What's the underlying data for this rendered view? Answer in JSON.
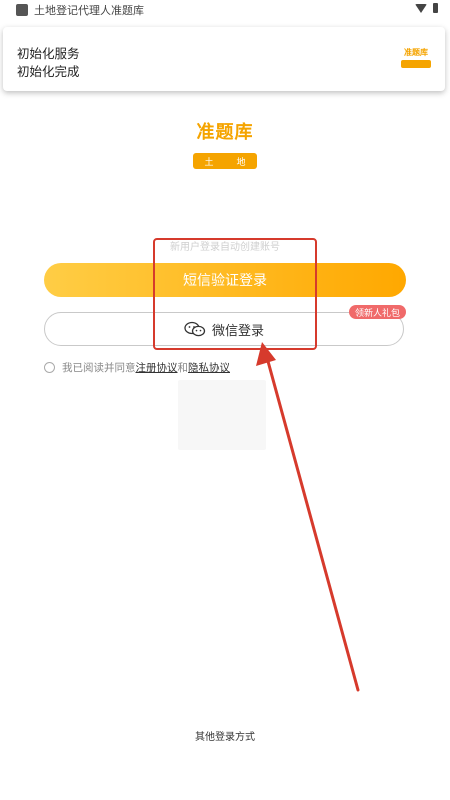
{
  "status_bar": {
    "title": "土地登记代理人准题库"
  },
  "notification": {
    "line1": "初始化服务",
    "line2": "初始化完成",
    "logo_text": "准题库"
  },
  "logo": {
    "title": "准题库",
    "ribbon_left": "土",
    "ribbon_right": "地"
  },
  "login": {
    "hint": "新用户登录自动创建账号",
    "sms_button": "短信验证登录",
    "wechat_button": "微信登录",
    "gift_badge": "领新人礼包",
    "agreement_prefix": "我已阅读并同意",
    "agreement_terms": "注册协议",
    "agreement_and": "和",
    "agreement_privacy": "隐私协议",
    "other_methods": "其他登录方式"
  },
  "colors": {
    "accent": "#f5a400",
    "gradient_start": "#ffcd45",
    "gradient_end": "#ffa800",
    "badge": "#f06a6a",
    "annotation": "#d63a2c"
  },
  "icons": [
    "wifi-icon",
    "battery-icon",
    "wechat-icon",
    "radio-icon"
  ]
}
